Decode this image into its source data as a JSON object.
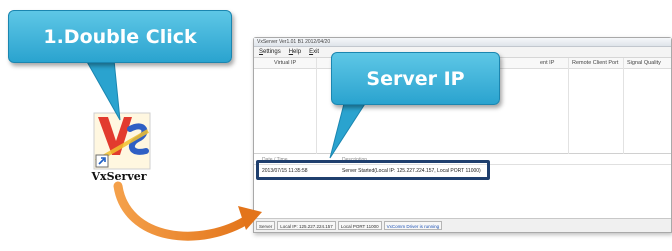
{
  "callouts": {
    "double_click": "1.Double Click",
    "server_ip": "Server IP"
  },
  "desktop_icon": {
    "label": "VxServer",
    "icon_name": "vxserver-app-icon"
  },
  "window": {
    "title": "VxServer Ver1.01 B1 2012/04/20",
    "menu": [
      "Settings",
      "Help",
      "Exit"
    ],
    "columns": [
      "Virtual IP",
      "ent IP",
      "Remote Client Port",
      "Signal Quality"
    ],
    "log_headers": [
      "Date / Time",
      "Description"
    ],
    "log_rows": [
      {
        "time": "2013/07/15 11:35:58",
        "message": "Server Started(Local IP: 125.227.224.157, Local PORT 11000)"
      }
    ],
    "status": [
      "Server",
      "Local IP: 125.227.224.157",
      "Local PORT 11000",
      "VxComm Driver is running"
    ]
  },
  "colors": {
    "callout": "#2aa3cf",
    "arrow": "#f08a24",
    "highlight_border": "#1f3f6e"
  }
}
